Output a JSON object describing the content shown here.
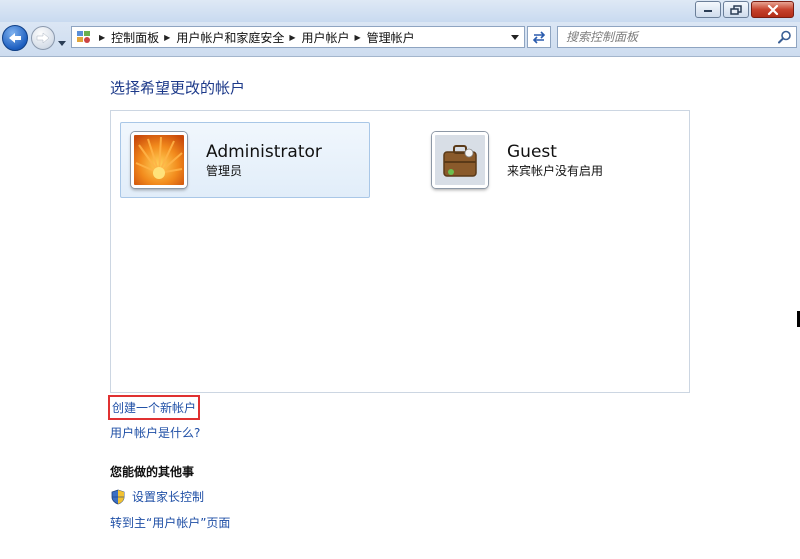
{
  "window": {
    "caption_buttons": [
      "minimize-icon",
      "restore-icon",
      "close-icon"
    ]
  },
  "nav": {
    "breadcrumbs": [
      {
        "label": "控制面板"
      },
      {
        "label": "用户帐户和家庭安全"
      },
      {
        "label": "用户帐户"
      },
      {
        "label": "管理帐户"
      }
    ],
    "search_placeholder": "搜索控制面板"
  },
  "content": {
    "heading": "选择希望更改的帐户",
    "accounts": [
      {
        "name": "Administrator",
        "role": "管理员",
        "selected": true,
        "icon": "flower-avatar"
      },
      {
        "name": "Guest",
        "role": "来宾帐户没有启用",
        "selected": false,
        "icon": "suitcase-avatar"
      }
    ],
    "create_account_link": "创建一个新帐户",
    "what_is_link": "用户帐户是什么?",
    "other_heading": "您能做的其他事",
    "parental_control_link": "设置家长控制",
    "goto_main_link": "转到主“用户帐户”页面"
  },
  "colors": {
    "link": "#1f4fa6",
    "heading": "#1d3a8a",
    "highlight_box": "#e03131",
    "selected_bg": "#e1edf9"
  }
}
